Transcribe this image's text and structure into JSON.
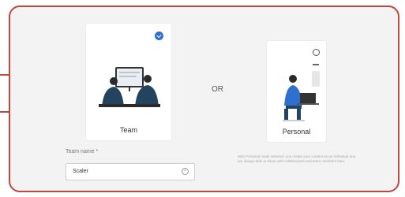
{
  "choice": {
    "team_label": "Team",
    "personal_label": "Personal",
    "or_label": "OR",
    "selected": "team"
  },
  "form": {
    "team_name_label": "Team name *",
    "team_name_value": "Scaler"
  },
  "helper": {
    "text": "With Personal mode selected, you create your content as an individual and are always able to share with collaborators and team members later."
  },
  "colors": {
    "callout_border": "#c0463f",
    "selected_radio": "#2f6fce"
  }
}
